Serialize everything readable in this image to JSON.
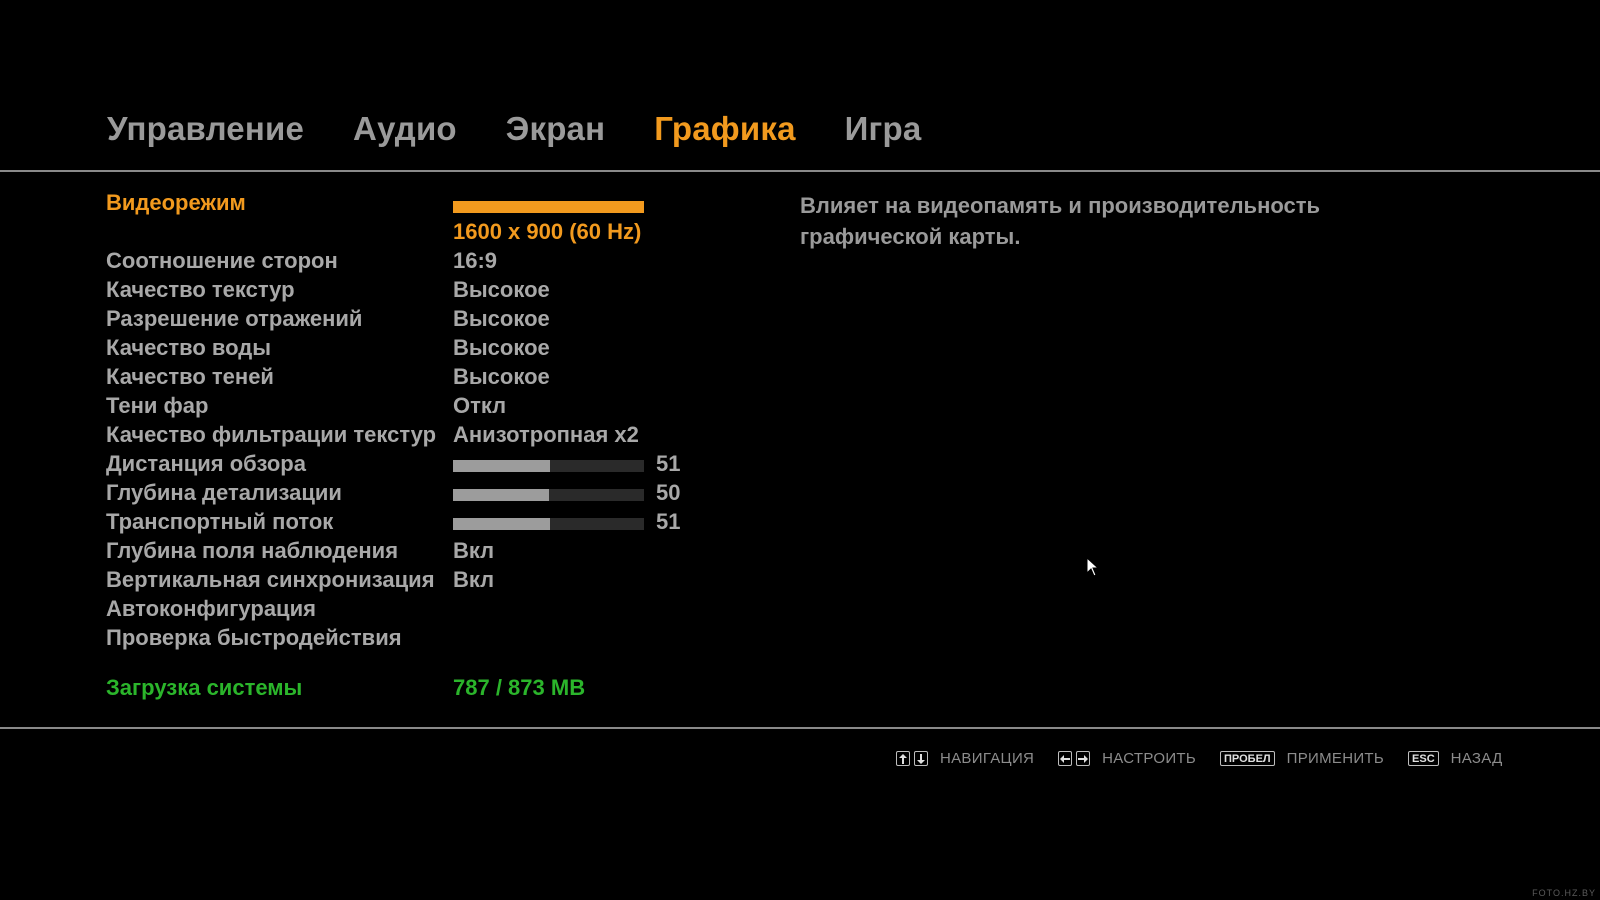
{
  "tabs": [
    {
      "label": "Управление",
      "active": false
    },
    {
      "label": "Аудио",
      "active": false
    },
    {
      "label": "Экран",
      "active": false
    },
    {
      "label": "Графика",
      "active": true
    },
    {
      "label": "Игра",
      "active": false
    }
  ],
  "settings": {
    "video_mode": {
      "label": "Видеорежим",
      "value": "1600 x 900 (60 Hz)"
    },
    "aspect_ratio": {
      "label": "Соотношение сторон",
      "value": "16:9"
    },
    "texture_quality": {
      "label": "Качество текстур",
      "value": "Высокое"
    },
    "reflection_resolution": {
      "label": "Разрешение отражений",
      "value": "Высокое"
    },
    "water_quality": {
      "label": "Качество воды",
      "value": "Высокое"
    },
    "shadow_quality": {
      "label": "Качество теней",
      "value": "Высокое"
    },
    "headlight_shadows": {
      "label": "Тени фар",
      "value": "Откл"
    },
    "texture_filter": {
      "label": "Качество фильтрации текстур",
      "value": "Анизотропная x2"
    },
    "view_distance": {
      "label": "Дистанция обзора",
      "value": "51",
      "fill_percent": 51
    },
    "detail_distance": {
      "label": "Глубина детализации",
      "value": "50",
      "fill_percent": 50
    },
    "vehicle_density": {
      "label": "Транспортный поток",
      "value": "51",
      "fill_percent": 51
    },
    "depth_of_field": {
      "label": "Глубина поля наблюдения",
      "value": "Вкл"
    },
    "vsync": {
      "label": "Вертикальная синхронизация",
      "value": "Вкл"
    },
    "autoconfig": {
      "label": "Автоконфигурация"
    },
    "benchmark": {
      "label": "Проверка быстродействия"
    },
    "system_load": {
      "label": "Загрузка системы",
      "value": "787 / 873 MB"
    }
  },
  "description": "Влияет на видеопамять и производительность графической карты.",
  "hints": {
    "navigate": "НАВИГАЦИЯ",
    "adjust": "НАСТРОИТЬ",
    "space_key": "ПРОБЕЛ",
    "apply": "ПРИМЕНИТЬ",
    "esc_key": "ESC",
    "back": "НАЗАД"
  },
  "watermark": "FOTO.HZ.BY",
  "colors": {
    "accent": "#f29a1e",
    "text": "#a8a8a8",
    "status": "#2bb52b"
  }
}
